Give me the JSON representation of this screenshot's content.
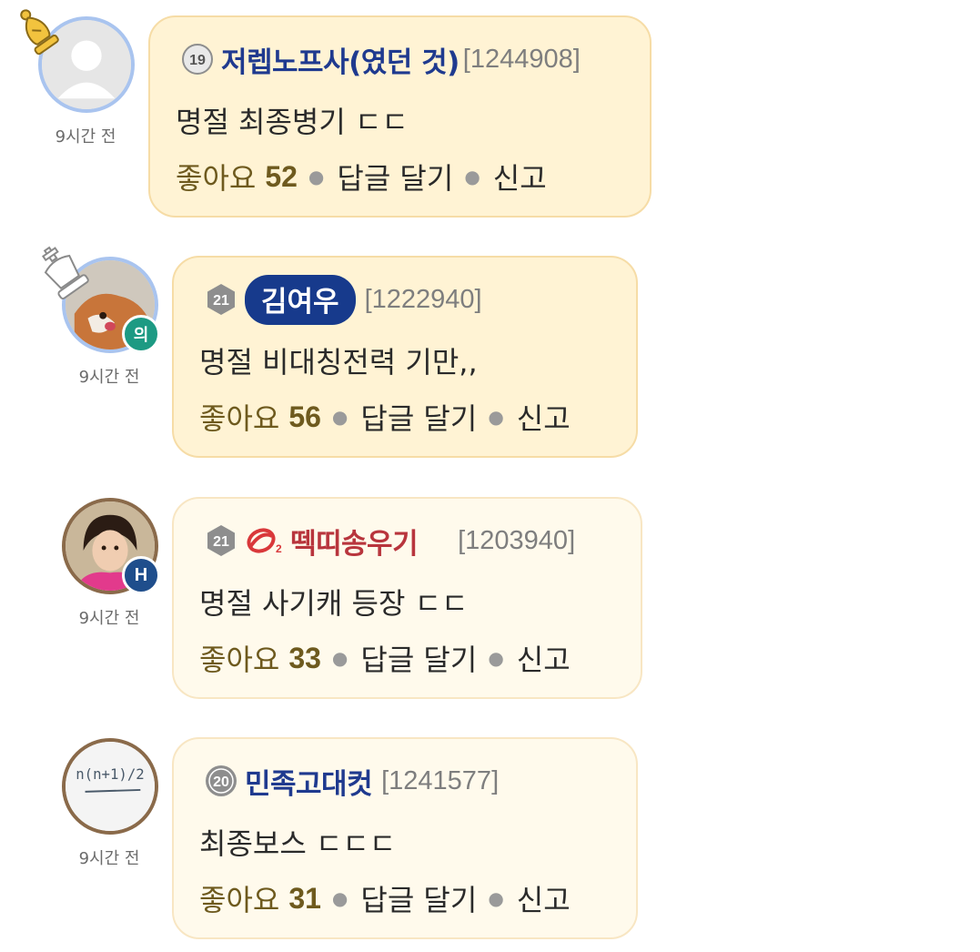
{
  "comments": [
    {
      "level": "19",
      "nickname": "저렙노프사(였던 것)",
      "user_id": "[1244908]",
      "time": "9시간 전",
      "content": "명절 최종병기 ㄷㄷ",
      "like_label": "좋아요",
      "likes": "52",
      "reply_label": "답글 달기",
      "report_label": "신고",
      "rank_piece": "bishop-gold-icon"
    },
    {
      "level": "21",
      "nickname": "김여우",
      "user_id": "[1222940]",
      "time": "9시간 전",
      "content": "명절 비대칭전력 기만,,",
      "like_label": "좋아요",
      "likes": "56",
      "reply_label": "답글 달기",
      "report_label": "신고",
      "rank_piece": "king-white-icon",
      "avatar_badge": "의"
    },
    {
      "level": "21",
      "nickname": "떽띠송우기",
      "user_id": "[1203940]",
      "time": "9시간 전",
      "content": "명절 사기캐 등장 ㄷㄷ",
      "like_label": "좋아요",
      "likes": "33",
      "reply_label": "답글 달기",
      "report_label": "신고",
      "avatar_badge": "H",
      "nick_icon": "o2-logo-icon"
    },
    {
      "level": "20",
      "nickname": "민족고대컷",
      "user_id": "[1241577]",
      "time": "9시간 전",
      "content": "최종보스 ㄷㄷㄷ",
      "like_label": "좋아요",
      "likes": "31",
      "reply_label": "답글 달기",
      "report_label": "신고",
      "avatar_text": "n(n+1)/2"
    }
  ],
  "colors": {
    "bubble_bg": "#fff3d4",
    "bubble_light_bg": "#fffaec",
    "nickname_blue": "#1f3a8f",
    "nickname_red": "#b8353d",
    "like_brown": "#6e5a1e"
  }
}
